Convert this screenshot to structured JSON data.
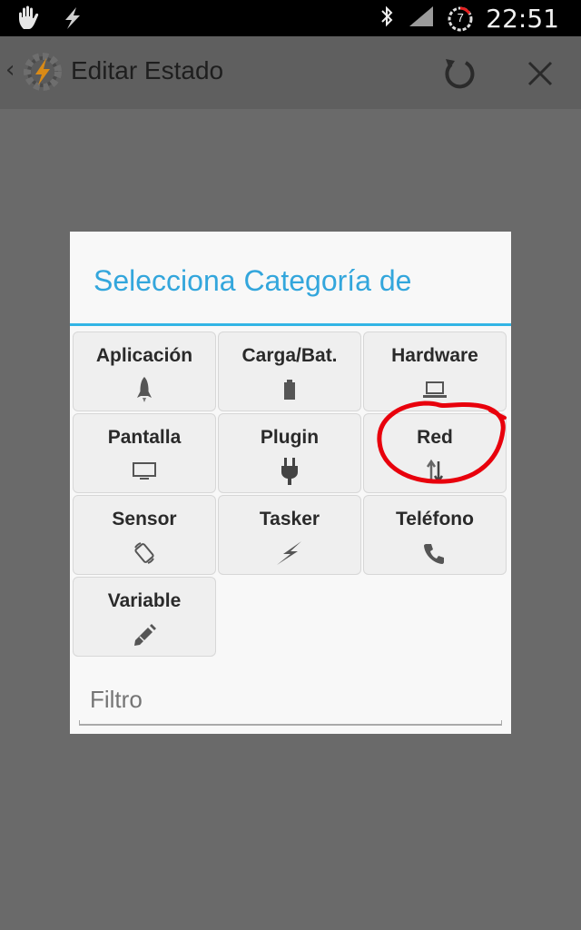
{
  "statusbar": {
    "time": "22:51",
    "battery_badge": "7"
  },
  "actionbar": {
    "back_glyph": "‹",
    "title": "Editar Estado"
  },
  "dialog": {
    "title": "Selecciona Categoría de",
    "categories": [
      {
        "label": "Aplicación",
        "icon": "rocket-icon"
      },
      {
        "label": "Carga/Bat.",
        "icon": "battery-icon"
      },
      {
        "label": "Hardware",
        "icon": "laptop-icon"
      },
      {
        "label": "Pantalla",
        "icon": "monitor-icon"
      },
      {
        "label": "Plugin",
        "icon": "plug-icon"
      },
      {
        "label": "Red",
        "icon": "network-arrows-icon"
      },
      {
        "label": "Sensor",
        "icon": "rotate-icon"
      },
      {
        "label": "Tasker",
        "icon": "lightning-icon"
      },
      {
        "label": "Teléfono",
        "icon": "phone-icon"
      },
      {
        "label": "Variable",
        "icon": "pencil-icon"
      }
    ],
    "filter_placeholder": "Filtro"
  },
  "colors": {
    "accent": "#33b5e5",
    "annotation": "#e8000c",
    "scrim": "#6a6a6a"
  }
}
